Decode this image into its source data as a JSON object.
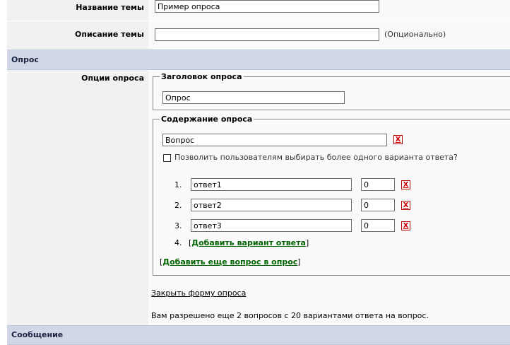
{
  "topic": {
    "title_label": "Название темы",
    "title_value": "Пример опроса",
    "desc_label": "Описание темы",
    "desc_value": "",
    "desc_hint": "(Опционально)"
  },
  "poll_section": {
    "header": "Опрос",
    "options_label": "Опции опроса",
    "poll_title_legend": "Заголовок опроса",
    "poll_title_value": "Опрос",
    "content_legend": "Содержание опроса",
    "question_value": "Вопрос",
    "delete_glyph": "X",
    "multi_choice_label": "Позволить пользователям выбирать более одного варианта ответа?",
    "answers": [
      {
        "num": "1.",
        "text": "ответ1",
        "votes": "0"
      },
      {
        "num": "2.",
        "text": "ответ2",
        "votes": "0"
      },
      {
        "num": "3.",
        "text": "ответ3",
        "votes": "0"
      }
    ],
    "add_answer_num": "4.",
    "add_answer_link": "Добавить вариант ответа",
    "add_question_link": "Добавить еще вопрос в опрос",
    "close_form_link": "Закрыть форму опроса",
    "limits_text": "Вам разрешено еще 2 вопросов с 20 вариантами ответа на вопрос."
  },
  "message_section": {
    "header": "Сообщение"
  }
}
